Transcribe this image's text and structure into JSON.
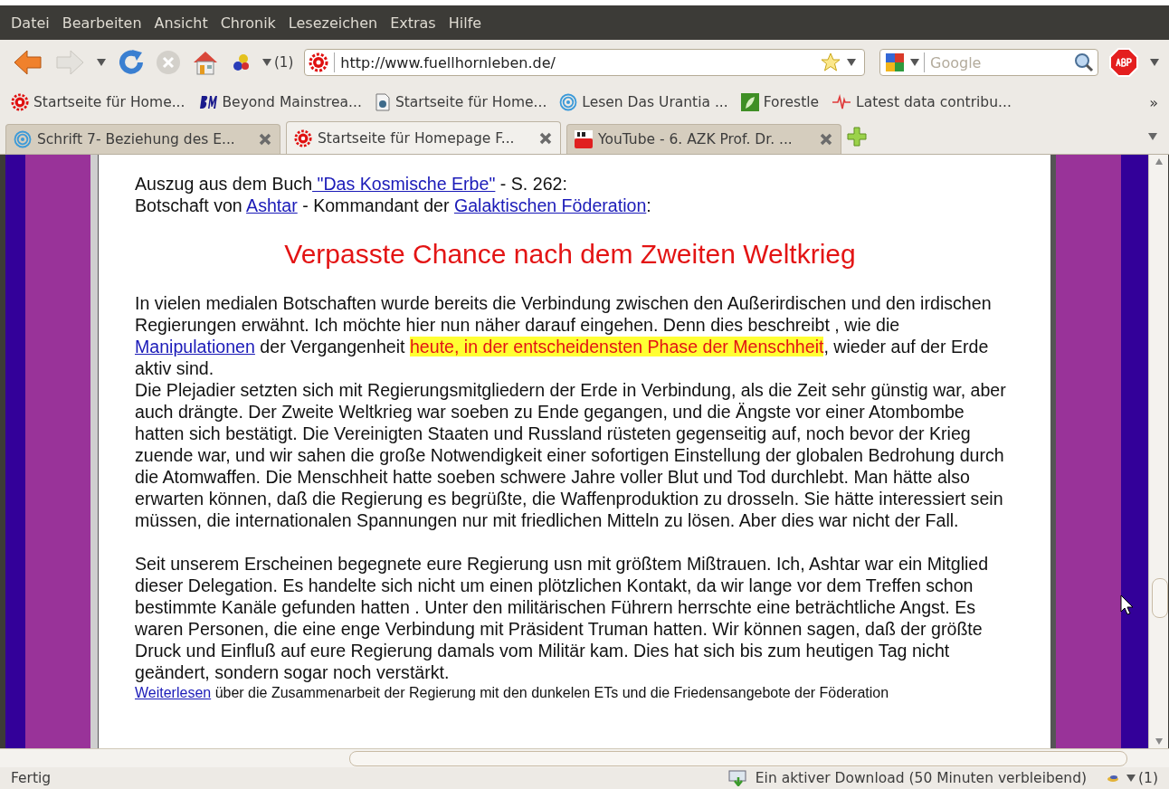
{
  "menu": [
    "Datei",
    "Bearbeiten",
    "Ansicht",
    "Chronik",
    "Lesezeichen",
    "Extras",
    "Hilfe"
  ],
  "toolbar": {
    "history_count": "(1)",
    "url": "http://www.fuellhornleben.de/",
    "search_placeholder": "Google"
  },
  "bookmarks": [
    {
      "kind": "gear",
      "label": "Startseite für Home..."
    },
    {
      "kind": "bm",
      "label": "Beyond Mainstrea..."
    },
    {
      "kind": "page",
      "label": "Startseite für Home..."
    },
    {
      "kind": "rings",
      "label": "Lesen Das Urantia ..."
    },
    {
      "kind": "leaf",
      "label": "Forestle"
    },
    {
      "kind": "pulse",
      "label": "Latest data contribu..."
    }
  ],
  "bookmarks_more": "»",
  "tabs": [
    {
      "kind": "rings",
      "label": "Schrift 7- Beziehung des E...",
      "selected": false
    },
    {
      "kind": "gear",
      "label": "Startseite für Homepage F...",
      "selected": true
    },
    {
      "kind": "youtube",
      "label": "YouTube - 6. AZK Prof. Dr. ...",
      "selected": false
    }
  ],
  "page": {
    "intro": [
      [
        {
          "kind": "text",
          "text": "Auszug aus dem Buch"
        },
        {
          "kind": "link",
          "text": " \"Das Kosmische Erbe\""
        },
        {
          "kind": "text",
          "text": " - S. 262:"
        }
      ],
      [
        {
          "kind": "text",
          "text": "Botschaft von "
        },
        {
          "kind": "link",
          "text": "Ashtar"
        },
        {
          "kind": "text",
          "text": " - Kommandant der "
        },
        {
          "kind": "link",
          "text": "Galaktischen Föderation"
        },
        {
          "kind": "text",
          "text": ":"
        }
      ]
    ],
    "heading": "Verpasste Chance nach dem Zweiten Weltkrieg",
    "paragraphs": [
      [
        {
          "kind": "text",
          "text": "In vielen medialen Botschaften wurde bereits die Verbindung zwischen den Außerirdischen und den irdischen Regierungen erwähnt. Ich möchte hier nun näher darauf eingehen. Denn dies beschreibt , wie die "
        },
        {
          "kind": "link",
          "text": "Manipulationen"
        },
        {
          "kind": "text",
          "text": " der Vergangenheit "
        },
        {
          "kind": "highlight",
          "text": "heute, in der entscheidensten Phase der Menschheit"
        },
        {
          "kind": "text",
          "text": ", wieder auf der Erde aktiv sind."
        }
      ],
      [
        {
          "kind": "text",
          "text": "Die Plejadier setzten sich mit Regierungsmitgliedern der Erde in Verbindung, als die Zeit sehr günstig war, aber auch drängte. Der Zweite Weltkrieg war soeben zu Ende gegangen, und die Ängste vor einer Atombombe hatten sich bestätigt. Die Vereinigten Staaten und Russland rüsteten gegenseitig auf, noch bevor der Krieg zuende war, und wir sahen die große Notwendigkeit einer sofortigen Einstellung der globalen Bedrohung durch die Atomwaffen. Die Menschheit hatte soeben schwere Jahre voller Blut und Tod durchlebt. Man hätte also erwarten können, daß die Regierung es begrüßte, die Waffenproduktion zu drosseln. Sie hätte interessiert sein müssen, die internationalen Spannungen nur mit friedlichen Mitteln zu lösen. Aber dies war nicht der Fall."
        }
      ],
      [
        {
          "kind": "text",
          "text": "Seit unserem Erscheinen begegnete eure Regierung usn mit größtem Mißtrauen. Ich, Ashtar war ein Mitglied dieser Delegation. Es handelte sich nicht um einen plötzlichen Kontakt, da wir lange vor dem Treffen schon bestimmte Kanäle gefunden hatten . Unter den militärischen Führern herrschte eine beträchtliche Angst. Es waren Personen, die eine enge Verbindung mit Präsident Truman hatten. Wir können sagen, daß der größte Druck und Einfluß auf eure Regierung damals vom Militär kam. Dies hat sich bis zum heutigen Tag nicht geändert, sondern sogar noch verstärkt."
        }
      ]
    ],
    "footnote": [
      {
        "kind": "link",
        "text": "Weiterlesen"
      },
      {
        "kind": "text",
        "text": " über die Zusammenarbeit der Regierung mit den dunkelen ETs und die Friedensangebote der Föderation"
      }
    ]
  },
  "status_bar": {
    "status": "Fertig",
    "download": "Ein aktiver Download (50 Minuten verbleibend)",
    "count": "(1)"
  }
}
